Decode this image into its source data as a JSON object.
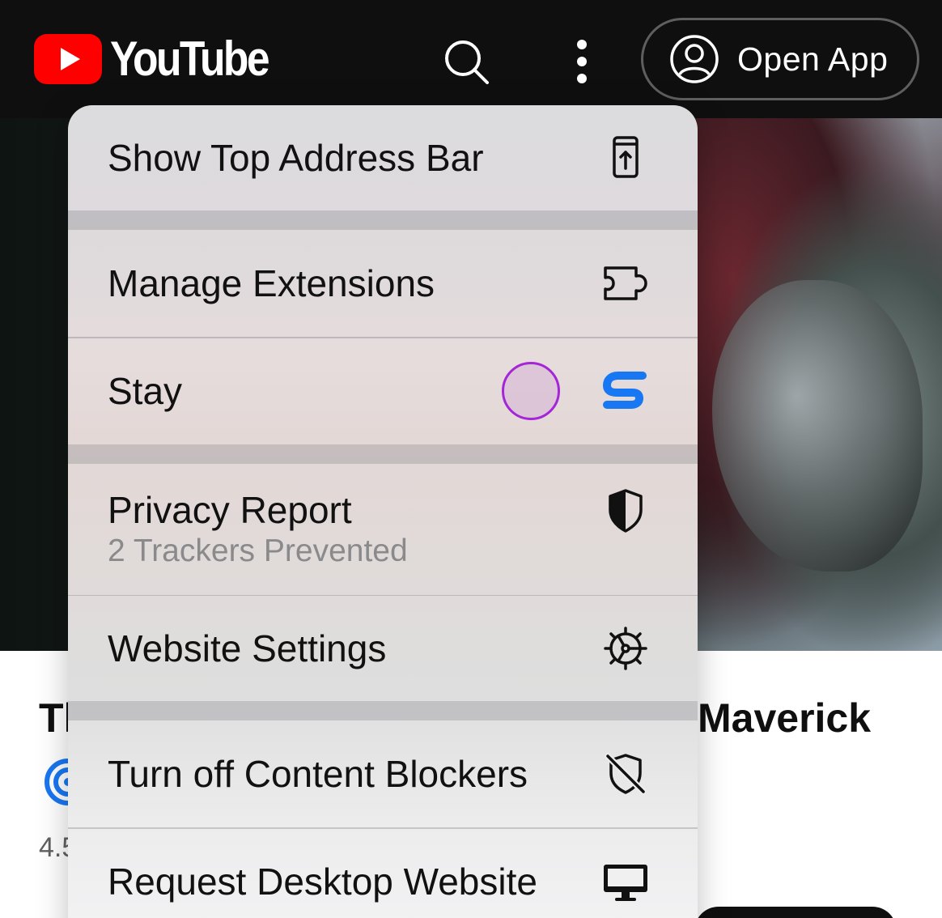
{
  "header": {
    "logo_text": "YouTube",
    "open_app_label": "Open App"
  },
  "video": {
    "title_start": "Tl",
    "title_end": "Maverick",
    "meta": "4.5"
  },
  "menu": {
    "items": [
      {
        "label": "Show Top Address Bar",
        "icon": "address-bar-up-icon"
      },
      {
        "label": "Manage Extensions",
        "icon": "puzzle-extension-icon"
      },
      {
        "label": "Stay",
        "icon": "stay-extension-icon"
      },
      {
        "label": "Privacy Report",
        "sublabel": "2 Trackers Prevented",
        "icon": "privacy-shield-icon"
      },
      {
        "label": "Website Settings",
        "icon": "gear-settings-icon"
      },
      {
        "label": "Turn off Content Blockers",
        "icon": "shield-slash-icon"
      },
      {
        "label": "Request Desktop Website",
        "icon": "desktop-monitor-icon"
      }
    ]
  },
  "colors": {
    "youtube_red": "#ff0000",
    "header_bg": "#0f0f0f",
    "stay_blue": "#1877f2",
    "touch_indicator": "#a526d6"
  }
}
